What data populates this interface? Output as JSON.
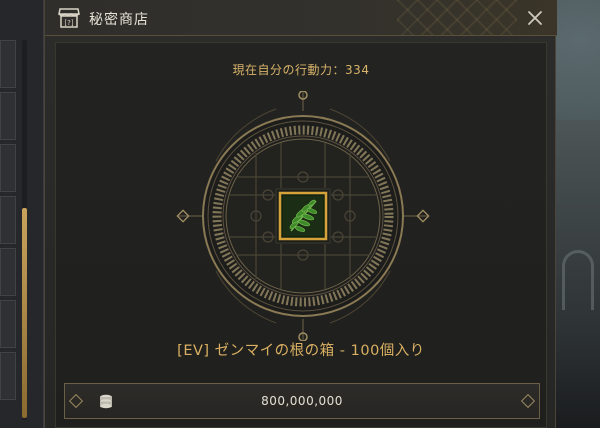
{
  "window": {
    "title": "秘密商店",
    "close_icon": "close-icon",
    "shop_icon": "shop-icon"
  },
  "player": {
    "action_power_text": "現在自分の行動力：334"
  },
  "item": {
    "name": "[EV] ゼンマイの根の箱 - 100個入り",
    "icon": "fern-leaf-icon"
  },
  "price": {
    "currency_icon": "silver-coin-stack-icon",
    "value": "800,000,000"
  },
  "colors": {
    "accent_gold": "#d8b36a",
    "panel_dark": "#232321",
    "title_text": "#e6e2d6",
    "item_frame": "#d6a23a",
    "leaf_green": "#3e8a2a"
  }
}
